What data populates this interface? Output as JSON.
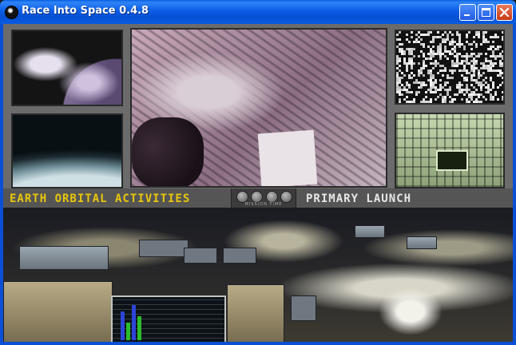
{
  "window": {
    "title": "Race Into Space 0.4.8",
    "minimize_icon": "minimize-icon",
    "maximize_icon": "maximize-icon",
    "close_icon": "close-icon"
  },
  "game": {
    "mission_label": "EARTH ORBITAL ACTIVITIES",
    "phase_label": "PRIMARY LAUNCH",
    "mission_time_label": "MISSION TIME"
  },
  "colors": {
    "mission_label": "#e8c60c",
    "phase_label": "#e6e6e6",
    "titlebar": "#0a5be0"
  }
}
